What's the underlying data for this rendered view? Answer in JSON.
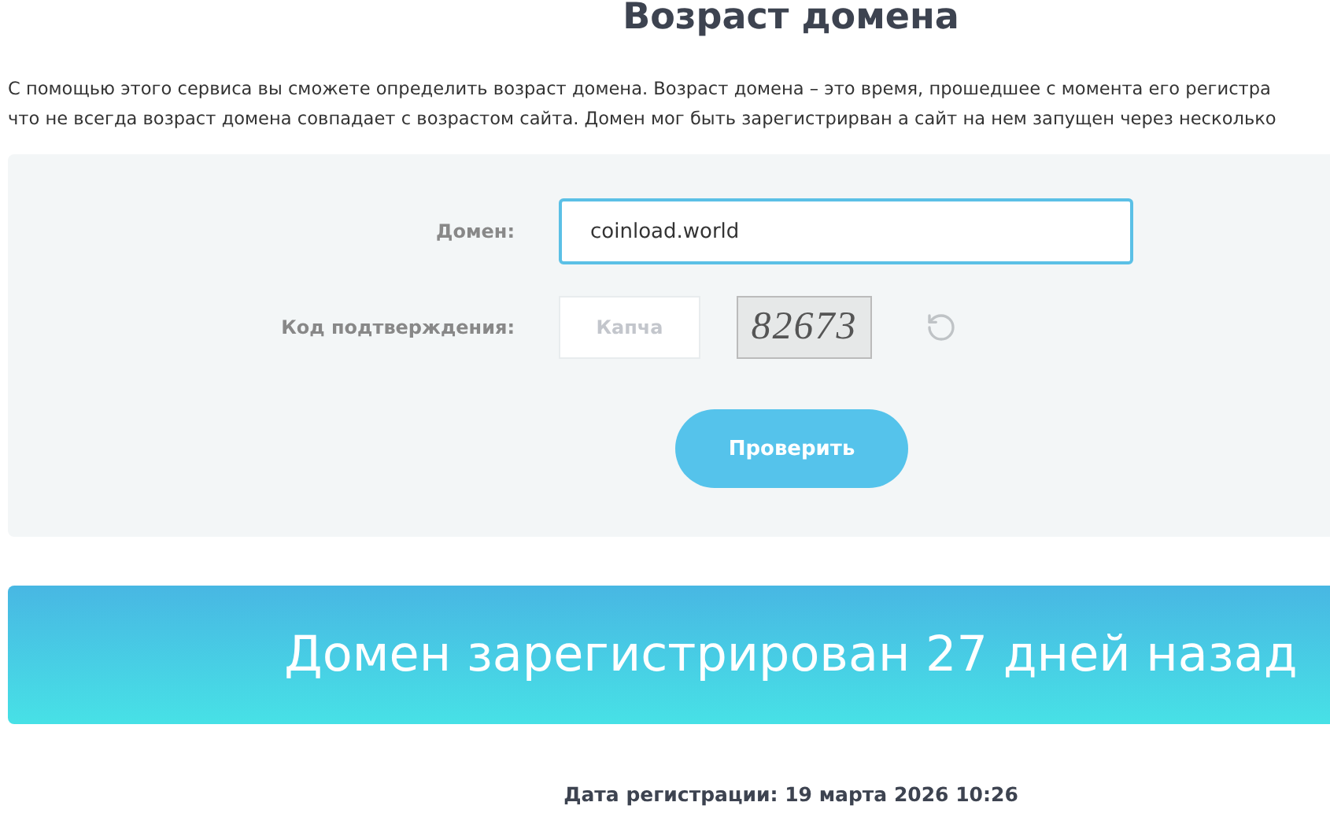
{
  "title": "Возраст домена",
  "intro_lines": [
    "С помощью этого сервиса вы сможете определить возраст домена. Возраст домена – это время, прошедшее с момента его регистра",
    "что не всегда возраст домена совпадает с возрастом сайта. Домен мог быть зарегистрирван а сайт на нем запущен через несколько"
  ],
  "form": {
    "domain_label": "Домен:",
    "domain_value": "coinload.world",
    "captcha_label": "Код подтверждения:",
    "captcha_placeholder": "Капча",
    "captcha_code": "82673",
    "submit": "Проверить"
  },
  "result": {
    "headline": "Домен зарегистрирован 27 дней назад",
    "registration_date": "Дата регистрации: 19 марта 2026 10:26"
  }
}
